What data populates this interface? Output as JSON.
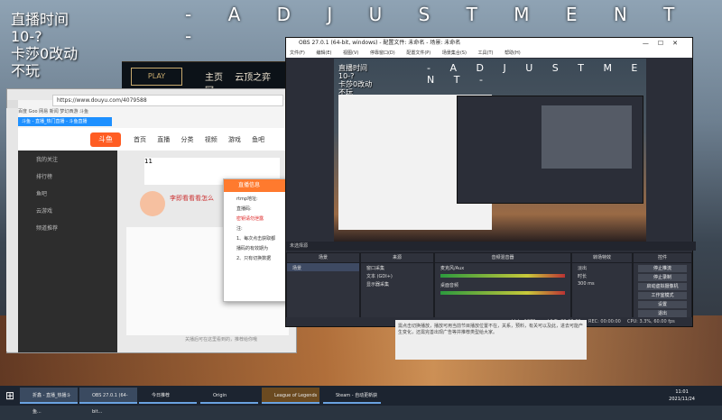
{
  "overlay": {
    "lines": "直播时间\n10-?\n卡莎0改动\n不玩",
    "banner": "- A D J U S T M E N T -"
  },
  "lol": {
    "play": "PLAY",
    "nav": [
      "主页",
      "云顶之弈",
      "冠"
    ]
  },
  "browser": {
    "url": "https://www.douyu.com/4079588",
    "tab": "斗鱼 - 直播_热门直播 - 斗鱼直播",
    "favbar": "百度   Goo   网易   新闻   梦幻西游   斗鱼",
    "logo": "斗鱼",
    "nav": [
      "首页",
      "直播",
      "分类",
      "视频",
      "游戏",
      "鱼吧"
    ],
    "sidebar": [
      "我的关注",
      "排行榜",
      "鱼吧",
      "云游戏",
      "频道推荐"
    ],
    "stat": "11",
    "room_title": "李即看看看怎么",
    "footer": "关播后可在这里看到的，推荐给你哦"
  },
  "dialog": {
    "title": "直播信息",
    "rtmp_label": "rtmp地址:",
    "key_label": "直播码:",
    "warning": "密钥请勿泄露",
    "notes": [
      "注:",
      "1、每次点击获取都",
      "播码的有效期为",
      "2、只有切换数据"
    ]
  },
  "obs": {
    "title": "OBS 27.0.1 (64-bit, windows) - 配置文件: 未命名 - 场景: 未命名",
    "menu": [
      "文件(F)",
      "编辑(E)",
      "视图(V)",
      "停靠窗口(D)",
      "配置文件(P)",
      "场景集合(S)",
      "工具(T)",
      "帮助(H)"
    ],
    "preview_text": "直播时间\n10-?\n卡莎0改动\n不玩",
    "preview_banner": "- A D J U S T M E N T -",
    "source_bar": "未选择源",
    "docks": {
      "scenes": {
        "title": "场景",
        "items": [
          "场景"
        ]
      },
      "sources": {
        "title": "来源",
        "items": [
          "窗口采集",
          "文本 (GDI+)",
          "显示器采集"
        ]
      },
      "mixer": {
        "title": "音频混音器",
        "tracks": [
          {
            "name": "麦克风/Aux",
            "db": "0.0 dB"
          },
          {
            "name": "桌面音频",
            "db": "0.0 dB"
          }
        ]
      },
      "transitions": {
        "title": "转场特效",
        "type": "淡出",
        "duration_label": "时长",
        "duration": "300 ms"
      },
      "controls": {
        "title": "控件",
        "buttons": [
          "停止推流",
          "停止录制",
          "启动虚拟摄像机",
          "工作室模式",
          "设置",
          "退出"
        ]
      }
    },
    "status": {
      "live": "LIVE: 00:00:00",
      "rec": "REC: 00:00:00",
      "cpu": "CPU: 3.3%, 60.00 fps",
      "bitrate": "kb/s: 1278"
    }
  },
  "doc_snippet": "需点击切换播放，播放可用当前节目播放位置不在，关系，预料，有关可以及此，进去可能产生变化，还需完善出现广告等并推荐类型给大家。",
  "taskbar": {
    "items": [
      "折鑫 - 直播_热播斗鱼...",
      "OBS 27.0.1 (64-bit...",
      "今日推荐",
      "Origin",
      "League of Legends",
      "Steam - 自动更新获"
    ],
    "time": "11:01",
    "date": "2021/11/24"
  }
}
